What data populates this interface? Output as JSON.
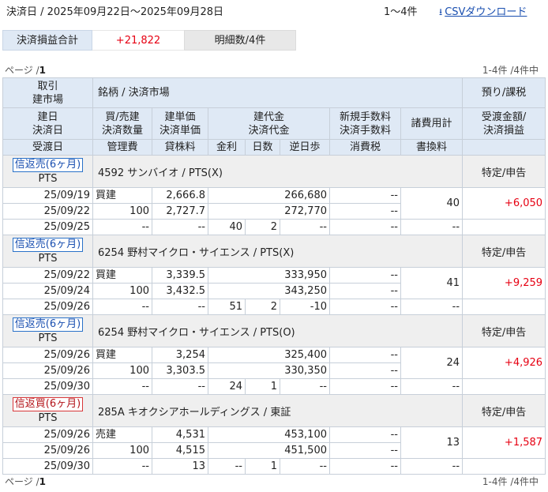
{
  "top": {
    "period": "決済日 / 2025年09月22日～2025年09月28日",
    "count": "1～4件",
    "csv_icon": "download-arrow-icon",
    "csv_label": "CSVダウンロード"
  },
  "summary": {
    "label": "決済損益合計",
    "value": "+21,822",
    "count": "明細数/4件"
  },
  "pager": {
    "prefix": "ページ /",
    "page": "1",
    "info": "1-4件 /4件中"
  },
  "headers": {
    "kbn": "取引\n建市場",
    "meigara": "銘柄 / 決済市場",
    "azukari": "預り/課税",
    "tatebi": "建日\n決済日",
    "baibai": "買/売建\n決済数量",
    "tanka": "建単価\n決済単価",
    "daikin": "建代金\n決済代金",
    "tesuryo": "新規手数料\n決済手数料",
    "shohi": "諸費用計",
    "ukewatashi": "受渡金額/\n決済損益",
    "ukewatashibi": "受渡日",
    "kanri": "管理費",
    "kashikabu": "貸株料",
    "kinri": "金利",
    "nissu": "日数",
    "gyakuhibu": "逆日歩",
    "shohizei": "消費税",
    "kakikae": "書換料"
  },
  "records": [
    {
      "type": "信返売(6ヶ月)",
      "type_kind": "sell",
      "market": "PTS",
      "name": "4592 サンバイオ / PTS(X)",
      "account": "特定/申告",
      "open_date": "25/09/19",
      "side": "買建",
      "open_price": "2,666.8",
      "open_amount": "266,680",
      "open_fee": "--",
      "close_date": "25/09/22",
      "qty": "100",
      "close_price": "2,727.7",
      "close_amount": "272,770",
      "close_fee": "--",
      "costs": "40",
      "pl": "+6,050",
      "settle_date": "25/09/25",
      "mgmt_fee": "--",
      "lending_fee": "--",
      "interest": "40",
      "days": "2",
      "reverse_fee": "--",
      "tax": "--",
      "transfer_fee": "--"
    },
    {
      "type": "信返売(6ヶ月)",
      "type_kind": "sell",
      "market": "PTS",
      "name": "6254 野村マイクロ・サイエンス / PTS(X)",
      "account": "特定/申告",
      "open_date": "25/09/22",
      "side": "買建",
      "open_price": "3,339.5",
      "open_amount": "333,950",
      "open_fee": "--",
      "close_date": "25/09/24",
      "qty": "100",
      "close_price": "3,432.5",
      "close_amount": "343,250",
      "close_fee": "--",
      "costs": "41",
      "pl": "+9,259",
      "settle_date": "25/09/26",
      "mgmt_fee": "--",
      "lending_fee": "--",
      "interest": "51",
      "days": "2",
      "reverse_fee": "-10",
      "tax": "--",
      "transfer_fee": "--"
    },
    {
      "type": "信返売(6ヶ月)",
      "type_kind": "sell",
      "market": "PTS",
      "name": "6254 野村マイクロ・サイエンス / PTS(O)",
      "account": "特定/申告",
      "open_date": "25/09/26",
      "side": "買建",
      "open_price": "3,254",
      "open_amount": "325,400",
      "open_fee": "--",
      "close_date": "25/09/26",
      "qty": "100",
      "close_price": "3,303.5",
      "close_amount": "330,350",
      "close_fee": "--",
      "costs": "24",
      "pl": "+4,926",
      "settle_date": "25/09/30",
      "mgmt_fee": "--",
      "lending_fee": "--",
      "interest": "24",
      "days": "1",
      "reverse_fee": "--",
      "tax": "--",
      "transfer_fee": "--"
    },
    {
      "type": "信返買(6ヶ月)",
      "type_kind": "buy",
      "market": "PTS",
      "name": "285A キオクシアホールディングス / 東証",
      "account": "特定/申告",
      "open_date": "25/09/26",
      "side": "売建",
      "open_price": "4,531",
      "open_amount": "453,100",
      "open_fee": "--",
      "close_date": "25/09/26",
      "qty": "100",
      "close_price": "4,515",
      "close_amount": "451,500",
      "close_fee": "--",
      "costs": "13",
      "pl": "+1,587",
      "settle_date": "25/09/30",
      "mgmt_fee": "--",
      "lending_fee": "13",
      "interest": "--",
      "days": "1",
      "reverse_fee": "--",
      "tax": "--",
      "transfer_fee": "--"
    }
  ]
}
